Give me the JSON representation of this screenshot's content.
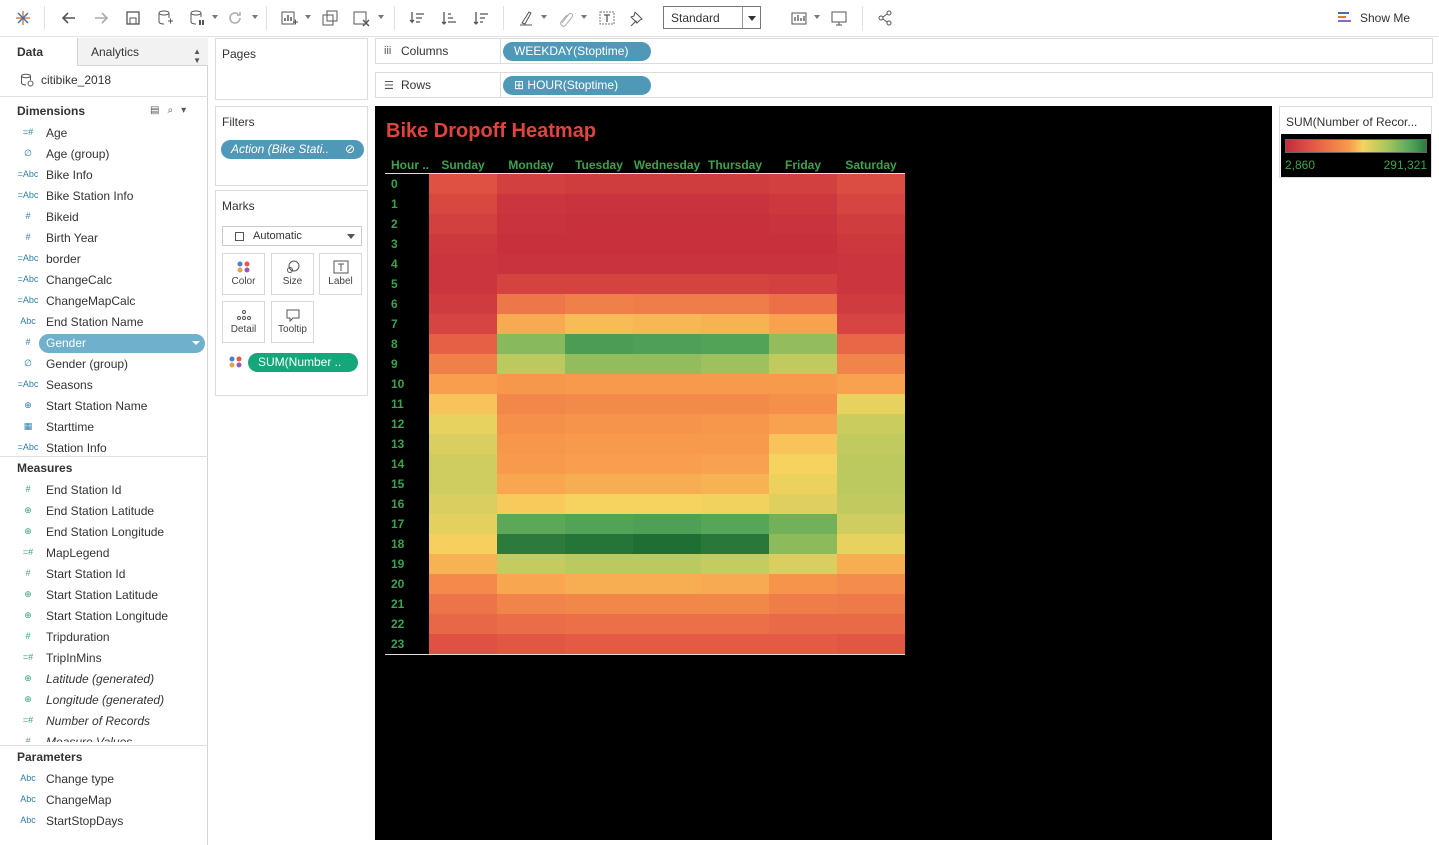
{
  "toolbar": {
    "fit_value": "Standard",
    "show_me_label": "Show Me",
    "icons": [
      "tableau-logo-icon",
      "undo-icon",
      "redo-icon",
      "save-icon",
      "new-datasource-icon",
      "pause-icon",
      "refresh-icon",
      "new-worksheet-icon",
      "duplicate-icon",
      "clear-icon",
      "swap-icon",
      "sort-asc-icon",
      "sort-desc-icon",
      "highlight-icon",
      "group-icon",
      "label-icon",
      "pin-icon",
      "show-cards-icon",
      "presentation-icon",
      "share-icon"
    ]
  },
  "left_pane": {
    "tabs": [
      "Data",
      "Analytics"
    ],
    "datasource": "citibike_2018",
    "dimensions_header": "Dimensions",
    "dimensions": [
      {
        "icon": "=#",
        "label": "Age",
        "italic": false
      },
      {
        "icon": "∅",
        "label": "Age (group)",
        "italic": false
      },
      {
        "icon": "=Abc",
        "label": "Bike Info",
        "italic": false
      },
      {
        "icon": "=Abc",
        "label": "Bike Station Info",
        "italic": false
      },
      {
        "icon": "#",
        "label": "Bikeid",
        "italic": false
      },
      {
        "icon": "#",
        "label": "Birth Year",
        "italic": false
      },
      {
        "icon": "=Abc",
        "label": "border",
        "italic": false
      },
      {
        "icon": "=Abc",
        "label": "ChangeCalc",
        "italic": false
      },
      {
        "icon": "=Abc",
        "label": "ChangeMapCalc",
        "italic": false
      },
      {
        "icon": "Abc",
        "label": "End Station Name",
        "italic": false
      },
      {
        "icon": "#",
        "label": "Gender",
        "italic": false,
        "selected": true
      },
      {
        "icon": "∅",
        "label": "Gender (group)",
        "italic": false
      },
      {
        "icon": "=Abc",
        "label": "Seasons",
        "italic": false
      },
      {
        "icon": "⊕",
        "label": "Start Station Name",
        "italic": false
      },
      {
        "icon": "▦",
        "label": "Starttime",
        "italic": false
      },
      {
        "icon": "=Abc",
        "label": "Station Info",
        "italic": false
      }
    ],
    "measures_header": "Measures",
    "measures": [
      {
        "icon": "#",
        "label": "End Station Id",
        "italic": false
      },
      {
        "icon": "⊕",
        "label": "End Station Latitude",
        "italic": false
      },
      {
        "icon": "⊕",
        "label": "End Station Longitude",
        "italic": false
      },
      {
        "icon": "=#",
        "label": "MapLegend",
        "italic": false
      },
      {
        "icon": "#",
        "label": "Start Station Id",
        "italic": false
      },
      {
        "icon": "⊕",
        "label": "Start Station Latitude",
        "italic": false
      },
      {
        "icon": "⊕",
        "label": "Start Station Longitude",
        "italic": false
      },
      {
        "icon": "#",
        "label": "Tripduration",
        "italic": false
      },
      {
        "icon": "=#",
        "label": "TripInMins",
        "italic": false
      },
      {
        "icon": "⊕",
        "label": "Latitude (generated)",
        "italic": true
      },
      {
        "icon": "⊕",
        "label": "Longitude (generated)",
        "italic": true
      },
      {
        "icon": "=#",
        "label": "Number of Records",
        "italic": true
      },
      {
        "icon": "#",
        "label": "Measure Values",
        "italic": true
      }
    ],
    "parameters_header": "Parameters",
    "parameters": [
      {
        "icon": "Abc",
        "label": "Change type"
      },
      {
        "icon": "Abc",
        "label": "ChangeMap"
      },
      {
        "icon": "Abc",
        "label": "StartStopDays"
      }
    ]
  },
  "cards": {
    "pages_title": "Pages",
    "filters_title": "Filters",
    "filter_pill": "Action (Bike Stati..",
    "marks_title": "Marks",
    "mark_type": "Automatic",
    "mark_buttons": [
      "Color",
      "Size",
      "Label",
      "Detail",
      "Tooltip"
    ],
    "marks_pill": "SUM(Number .."
  },
  "shelves": {
    "columns_label": "Columns",
    "columns_pill": "WEEKDAY(Stoptime)",
    "rows_label": "Rows",
    "rows_pill": "HOUR(Stoptime)"
  },
  "legend": {
    "title": "SUM(Number of Recor...",
    "min_label": "2,860",
    "max_label": "291,321"
  },
  "chart_data": {
    "type": "heatmap",
    "title": "Bike Dropoff Heatmap",
    "row_header": "Hour ..",
    "x": [
      "Sunday",
      "Monday",
      "Tuesday",
      "Wednesday",
      "Thursday",
      "Friday",
      "Saturday"
    ],
    "y": [
      0,
      1,
      2,
      3,
      4,
      5,
      6,
      7,
      8,
      9,
      10,
      11,
      12,
      13,
      14,
      15,
      16,
      17,
      18,
      19,
      20,
      21,
      22,
      23
    ],
    "color_range": [
      2860,
      291321
    ],
    "values_normalized_0_to_1": [
      [
        0.15,
        0.08,
        0.07,
        0.07,
        0.07,
        0.08,
        0.13
      ],
      [
        0.11,
        0.04,
        0.03,
        0.03,
        0.03,
        0.05,
        0.1
      ],
      [
        0.08,
        0.03,
        0.02,
        0.02,
        0.02,
        0.03,
        0.07
      ],
      [
        0.05,
        0.02,
        0.02,
        0.02,
        0.02,
        0.02,
        0.05
      ],
      [
        0.04,
        0.03,
        0.03,
        0.03,
        0.03,
        0.03,
        0.04
      ],
      [
        0.04,
        0.09,
        0.09,
        0.09,
        0.09,
        0.08,
        0.04
      ],
      [
        0.06,
        0.27,
        0.3,
        0.29,
        0.29,
        0.25,
        0.06
      ],
      [
        0.1,
        0.42,
        0.46,
        0.45,
        0.44,
        0.4,
        0.1
      ],
      [
        0.2,
        0.74,
        0.86,
        0.85,
        0.84,
        0.72,
        0.22
      ],
      [
        0.3,
        0.64,
        0.72,
        0.72,
        0.7,
        0.63,
        0.31
      ],
      [
        0.39,
        0.37,
        0.38,
        0.38,
        0.38,
        0.38,
        0.4
      ],
      [
        0.48,
        0.32,
        0.33,
        0.33,
        0.33,
        0.35,
        0.55
      ],
      [
        0.55,
        0.35,
        0.36,
        0.36,
        0.37,
        0.4,
        0.61
      ],
      [
        0.58,
        0.37,
        0.38,
        0.38,
        0.38,
        0.48,
        0.63
      ],
      [
        0.6,
        0.38,
        0.39,
        0.39,
        0.4,
        0.52,
        0.64
      ],
      [
        0.6,
        0.41,
        0.43,
        0.43,
        0.44,
        0.54,
        0.64
      ],
      [
        0.58,
        0.5,
        0.52,
        0.52,
        0.53,
        0.57,
        0.63
      ],
      [
        0.56,
        0.82,
        0.84,
        0.85,
        0.83,
        0.78,
        0.6
      ],
      [
        0.51,
        0.96,
        0.98,
        1.0,
        0.97,
        0.73,
        0.55
      ],
      [
        0.44,
        0.62,
        0.64,
        0.64,
        0.62,
        0.58,
        0.43
      ],
      [
        0.33,
        0.41,
        0.43,
        0.43,
        0.42,
        0.36,
        0.34
      ],
      [
        0.26,
        0.31,
        0.32,
        0.32,
        0.32,
        0.29,
        0.28
      ],
      [
        0.22,
        0.24,
        0.25,
        0.25,
        0.25,
        0.23,
        0.23
      ],
      [
        0.15,
        0.17,
        0.18,
        0.18,
        0.18,
        0.18,
        0.17
      ]
    ],
    "colors": {
      "title": "#e0443c",
      "axis_labels": "#3da24e",
      "low": "#c42b3b",
      "mid": "#f6d35f",
      "high": "#1f6e33"
    }
  }
}
